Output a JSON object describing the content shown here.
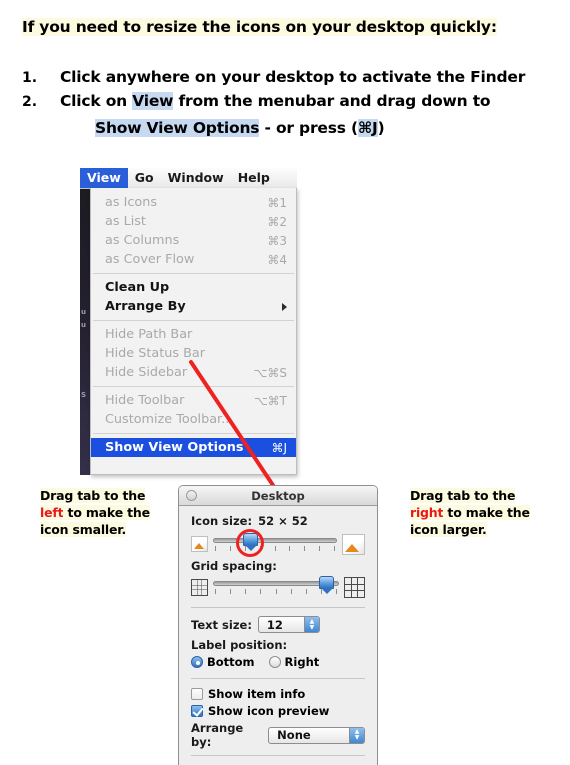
{
  "instructions": {
    "title": "If you need to resize the icons on your desktop quickly:",
    "steps": [
      {
        "num": "1.",
        "text_before": "Click anywhere on your desktop to activate the Finder"
      },
      {
        "num": "2.",
        "text_a": "Click on ",
        "hl_a": "View",
        "text_b": " from the menubar and drag down to"
      }
    ],
    "step2_second_line": {
      "hl_a": "Show View Options",
      "mid": " -  or press (",
      "hl_b": "⌘J",
      "end": ")"
    },
    "highlight_yellow": "#fdfbdf",
    "highlight_blue": "#c6d9f1"
  },
  "finder_menubar": {
    "items": [
      {
        "label": "View",
        "active": true
      },
      {
        "label": "Go",
        "active": false
      },
      {
        "label": "Window",
        "active": false
      },
      {
        "label": "Help",
        "active": false
      }
    ],
    "active_color": "#2b5fd9"
  },
  "view_menu": {
    "groups": [
      {
        "items": [
          {
            "label": "as Icons",
            "shortcut": "⌘1",
            "enabled": false
          },
          {
            "label": "as List",
            "shortcut": "⌘2",
            "enabled": false
          },
          {
            "label": "as Columns",
            "shortcut": "⌘3",
            "enabled": false
          },
          {
            "label": "as Cover Flow",
            "shortcut": "⌘4",
            "enabled": false
          }
        ]
      },
      {
        "items": [
          {
            "label": "Clean Up",
            "shortcut": "",
            "enabled": true
          },
          {
            "label": "Arrange By",
            "shortcut": "",
            "enabled": true,
            "submenu": true
          }
        ]
      },
      {
        "items": [
          {
            "label": "Hide Path Bar",
            "shortcut": "",
            "enabled": false
          },
          {
            "label": "Hide Status Bar",
            "shortcut": "",
            "enabled": false
          },
          {
            "label": "Hide Sidebar",
            "shortcut": "⌥⌘S",
            "enabled": false
          }
        ]
      },
      {
        "items": [
          {
            "label": "Hide Toolbar",
            "shortcut": "⌥⌘T",
            "enabled": false
          },
          {
            "label": "Customize Toolbar...",
            "shortcut": "",
            "enabled": false
          }
        ]
      },
      {
        "items": [
          {
            "label": "Show View Options",
            "shortcut": "⌘J",
            "enabled": true,
            "selected": true
          }
        ]
      }
    ],
    "selected_color": "#1a4fe0"
  },
  "annotations": {
    "left": {
      "l1": "Drag tab to the ",
      "red": "left",
      "l2": " to make the",
      "l3": "icon smaller."
    },
    "right": {
      "l1": "Drag tab to the ",
      "red": "right",
      "l2": " to make the",
      "l3": "icon larger."
    },
    "red_color": "#e8191a"
  },
  "view_options_panel": {
    "window_title": "Desktop",
    "icon_size": {
      "label": "Icon size:",
      "value": "52 × 52",
      "slider_percent": 30,
      "tick_count": 9
    },
    "grid_spacing": {
      "label": "Grid spacing:",
      "slider_percent": 90,
      "tick_count": 9
    },
    "text_size": {
      "label": "Text size:",
      "value": "12"
    },
    "label_position": {
      "label": "Label position:",
      "options": [
        {
          "label": "Bottom",
          "selected": true
        },
        {
          "label": "Right",
          "selected": false
        }
      ]
    },
    "checkboxes": [
      {
        "label": "Show item info",
        "checked": false
      },
      {
        "label": "Show icon preview",
        "checked": true
      }
    ],
    "arrange_by": {
      "label": "Arrange by:",
      "value": "None"
    }
  }
}
